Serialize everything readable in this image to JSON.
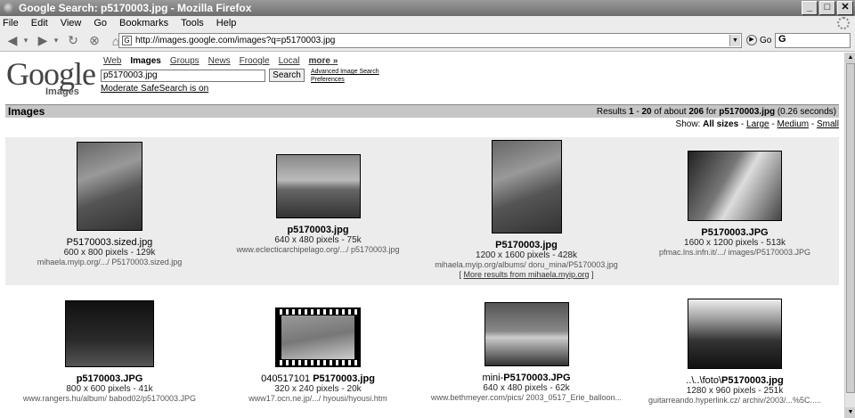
{
  "window": {
    "title": "Google Search: p5170003.jpg - Mozilla Firefox"
  },
  "menu": [
    "File",
    "Edit",
    "View",
    "Go",
    "Bookmarks",
    "Tools",
    "Help"
  ],
  "nav": {
    "url": "http://images.google.com/images?q=p5170003.jpg",
    "go_label": "Go",
    "search_value": "G"
  },
  "google": {
    "logo": "Google",
    "logo_sub": "Images",
    "tabs": [
      "Web",
      "Images",
      "Groups",
      "News",
      "Froogle",
      "Local",
      "more »"
    ],
    "query": "p5170003.jpg",
    "search_button": "Search",
    "advanced": "Advanced Image Search",
    "preferences": "Preferences",
    "safesearch": "Moderate SafeSearch is on"
  },
  "results_bar": {
    "title": "Images",
    "results_prefix": "Results ",
    "range_start": "1",
    "range_sep": " - ",
    "range_end": "20",
    "of_about": " of about ",
    "total": "206",
    "for": " for ",
    "query": "p5170003.jpg",
    "time": " (0.26 seconds)"
  },
  "size_filter": {
    "show": "Show:",
    "all": "All sizes",
    "large": "Large",
    "medium": "Medium",
    "small": "Small",
    "sep": " - "
  },
  "images": [
    {
      "pre": "",
      "bold": "",
      "post": "P5170003.sized.jpg",
      "meta": "600 x 800 pixels - 129k",
      "src": "mihaela.myip.org/.../ P5170003.sized.jpg"
    },
    {
      "pre": "",
      "bold": "p5170003.jpg",
      "post": "",
      "meta": "640 x 480 pixels - 75k",
      "src": "www.eclecticarchipelago.org/.../ p5170003.jpg"
    },
    {
      "pre": "",
      "bold": "P5170003.jpg",
      "post": "",
      "meta": "1200 x 1600 pixels - 428k",
      "src": "mihaela.myip.org/albums/ doru_mina/P5170003.jpg",
      "more_pre": "[ ",
      "more": "More results from mihaela.myip.org",
      "more_post": " ]"
    },
    {
      "pre": "",
      "bold": "P5170003.JPG",
      "post": "",
      "meta": "1600 x 1200 pixels - 513k",
      "src": "pfmac.lns.infn.it/.../ images/P5170003.JPG"
    },
    {
      "pre": "",
      "bold": "p5170003.JPG",
      "post": "",
      "meta": "800 x 600 pixels - 41k",
      "src": "www.rangers.hu/album/ babod02/p5170003.JPG"
    },
    {
      "pre": "040517101 ",
      "bold": "P5170003.jpg",
      "post": "",
      "meta": "320 x 240 pixels - 20k",
      "src": "www17.ocn.ne.jp/.../ hyousi/hyousi.htm"
    },
    {
      "pre": "mini-",
      "bold": "P5170003.JPG",
      "post": "",
      "meta": "640 x 480 pixels - 62k",
      "src": "www.bethmeyer.com/pics/ 2003_0517_Erie_balloon..."
    },
    {
      "pre": "..\\..\\foto\\",
      "bold": "P5170003.jpg",
      "post": "",
      "meta": "1280 x 960 pixels - 251k",
      "src": "guitarreando.hyperlink.cz/ archiv/2003/...%5C....."
    }
  ]
}
